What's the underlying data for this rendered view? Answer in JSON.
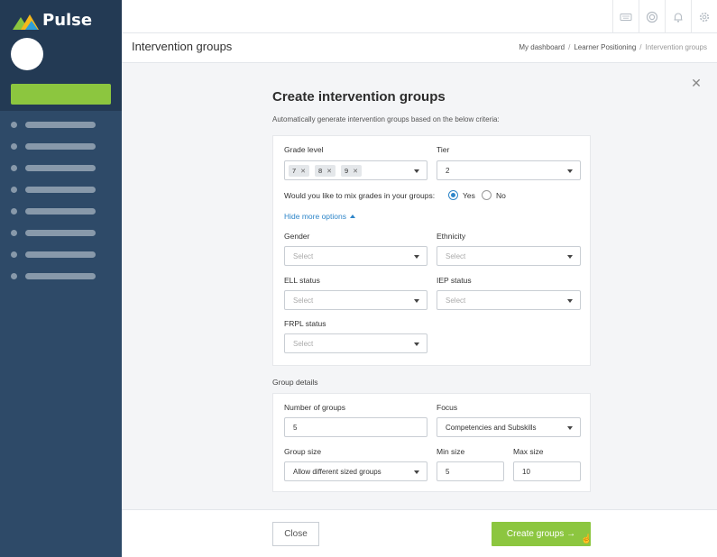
{
  "brand": {
    "name": "Pulse"
  },
  "topbar": {
    "icons": [
      "keyboard-icon",
      "lifebuoy-icon",
      "bell-icon",
      "gear-icon"
    ]
  },
  "page": {
    "title": "Intervention groups",
    "breadcrumb": [
      "My dashboard",
      "Learner Positioning",
      "Intervention groups"
    ]
  },
  "modal": {
    "title": "Create intervention groups",
    "subtitle": "Automatically generate intervention groups based on the below criteria:",
    "grade_level": {
      "label": "Grade level",
      "chips": [
        "7",
        "8",
        "9"
      ]
    },
    "tier": {
      "label": "Tier",
      "value": "2"
    },
    "mix_question": "Would you like to mix grades in your groups:",
    "mix_options": {
      "yes": "Yes",
      "no": "No",
      "selected": "Yes"
    },
    "toggle_link": "Hide more options",
    "gender": {
      "label": "Gender",
      "placeholder": "Select"
    },
    "ethnicity": {
      "label": "Ethnicity",
      "placeholder": "Select"
    },
    "ell": {
      "label": "ELL status",
      "placeholder": "Select"
    },
    "iep": {
      "label": "IEP status",
      "placeholder": "Select"
    },
    "frpl": {
      "label": "FRPL status",
      "placeholder": "Select"
    },
    "group_details": {
      "heading": "Group details",
      "number_of_groups": {
        "label": "Number of groups",
        "value": "5"
      },
      "focus": {
        "label": "Focus",
        "value": "Competencies and Subskills"
      },
      "group_size": {
        "label": "Group size",
        "value": "Allow different sized groups"
      },
      "min_size": {
        "label": "Min size",
        "value": "5"
      },
      "max_size": {
        "label": "Max size",
        "value": "10"
      }
    }
  },
  "footer": {
    "close_label": "Close",
    "create_label": "Create groups →"
  },
  "colors": {
    "accent_green": "#8cc63f",
    "link_blue": "#2f86c9",
    "sidebar": "#2e4a68"
  }
}
